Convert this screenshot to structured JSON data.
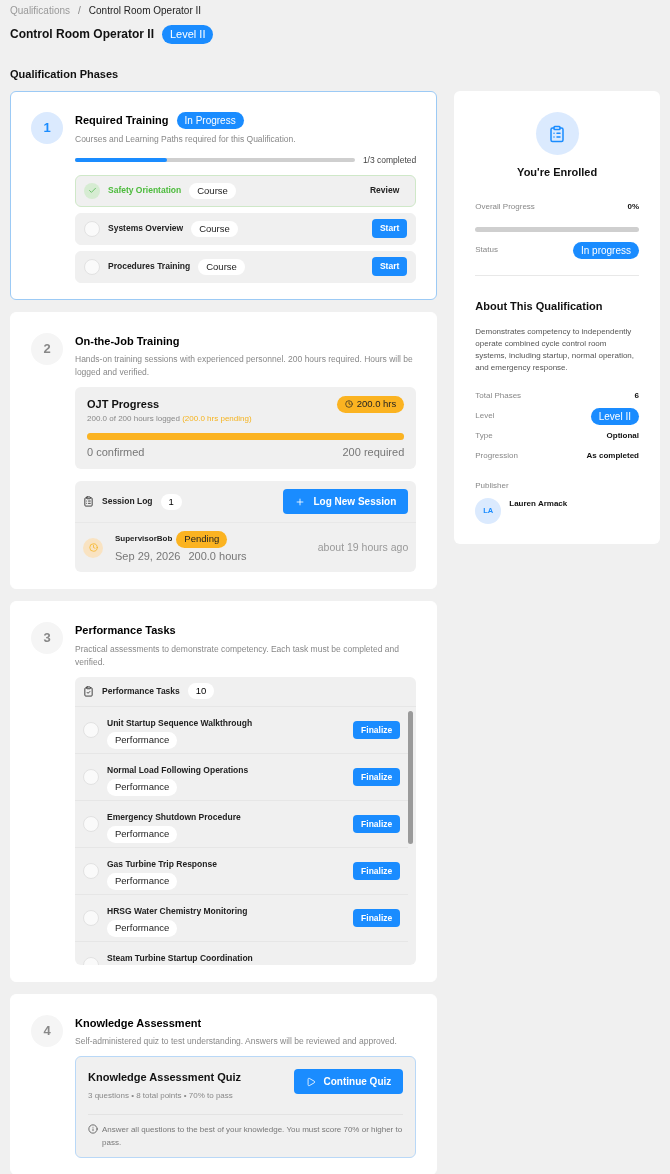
{
  "breadcrumb": [
    {
      "label": "Qualifications",
      "current": false
    },
    {
      "label": "Control Room Operator II",
      "current": true
    }
  ],
  "breadcrumb_separator": "/",
  "title": "Control Room Operator II",
  "level_badge": "Level II",
  "section_title": "Qualification Phases",
  "phases": [
    {
      "kind": "courses",
      "number": "1",
      "title": "Required Training",
      "status": "In Progress",
      "active": true,
      "description": "Courses and Learning Paths required for this Qualification.",
      "progress": {
        "level": 0.33,
        "label": "1/3 completed"
      },
      "items": [
        {
          "name": "Safety Orientation",
          "type": "Course",
          "completed": true,
          "action": "Review"
        },
        {
          "name": "Systems Overview",
          "type": "Course",
          "completed": false,
          "action": "Start"
        },
        {
          "name": "Procedures Training",
          "type": "Course",
          "completed": false,
          "action": "Start"
        }
      ]
    },
    {
      "kind": "ojt",
      "number": "2",
      "title": "On-the-Job Training",
      "active": false,
      "description": "Hands-on training sessions with experienced personnel. 200 hours required. Hours will be logged and verified.",
      "ojt": {
        "title": "OJT Progress",
        "logged": "200.0 of 200 hours logged",
        "pending": "(200.0 hrs pending)",
        "hours_badge": "200.0 hrs",
        "level": 1,
        "confirmed": "0 confirmed",
        "required": "200 required"
      },
      "log": {
        "title": "Session Log",
        "count": "1",
        "button": "Log New Session",
        "sessions": [
          {
            "supervisor": "SupervisorBob",
            "status": "Pending",
            "date": "Sep 29, 2026",
            "hours": "200.0 hours",
            "ago": "about 19 hours ago"
          }
        ]
      }
    },
    {
      "kind": "tasks",
      "number": "3",
      "title": "Performance Tasks",
      "active": false,
      "description": "Practical assessments to demonstrate competency. Each task must be completed and verified.",
      "list_title": "Performance Tasks",
      "count": "10",
      "tasks": [
        {
          "name": "Unit Startup Sequence Walkthrough",
          "type": "Performance",
          "action": "Finalize"
        },
        {
          "name": "Normal Load Following Operations",
          "type": "Performance",
          "action": "Finalize"
        },
        {
          "name": "Emergency Shutdown Procedure",
          "type": "Performance",
          "action": "Finalize"
        },
        {
          "name": "Gas Turbine Trip Response",
          "type": "Performance",
          "action": "Finalize"
        },
        {
          "name": "HRSG Water Chemistry Monitoring",
          "type": "Performance",
          "action": "Finalize"
        },
        {
          "name": "Steam Turbine Startup Coordination"
        }
      ]
    },
    {
      "kind": "quiz",
      "number": "4",
      "title": "Knowledge Assessment",
      "active": false,
      "description": "Self-administered quiz to test understanding. Answers will be reviewed and approved.",
      "quiz": {
        "title": "Knowledge Assessment Quiz",
        "meta": "3 questions • 8 total points • 70% to pass",
        "button": "Continue Quiz",
        "note": "Answer all questions to the best of your knowledge. You must score 70% or higher to pass."
      }
    }
  ],
  "sidebar": {
    "enrolled": "You're Enrolled",
    "progress": {
      "label": "Overall Progress",
      "value": "0%",
      "level": 0
    },
    "status_label": "Status",
    "status": "In progress",
    "about_title": "About This Qualification",
    "about": "Demonstrates competency to independently operate combined cycle control room systems, including startup, normal operation, and emergency response.",
    "details": [
      {
        "label": "Total Phases",
        "value": "6",
        "kind": "text"
      },
      {
        "label": "Level",
        "value": "Level II",
        "kind": "badge"
      },
      {
        "label": "Type",
        "value": "Optional",
        "kind": "text"
      },
      {
        "label": "Progression",
        "value": "As completed",
        "kind": "text"
      }
    ],
    "publisher_label": "Publisher",
    "publisher": {
      "initials": "LA",
      "name": "Lauren Armack"
    }
  }
}
